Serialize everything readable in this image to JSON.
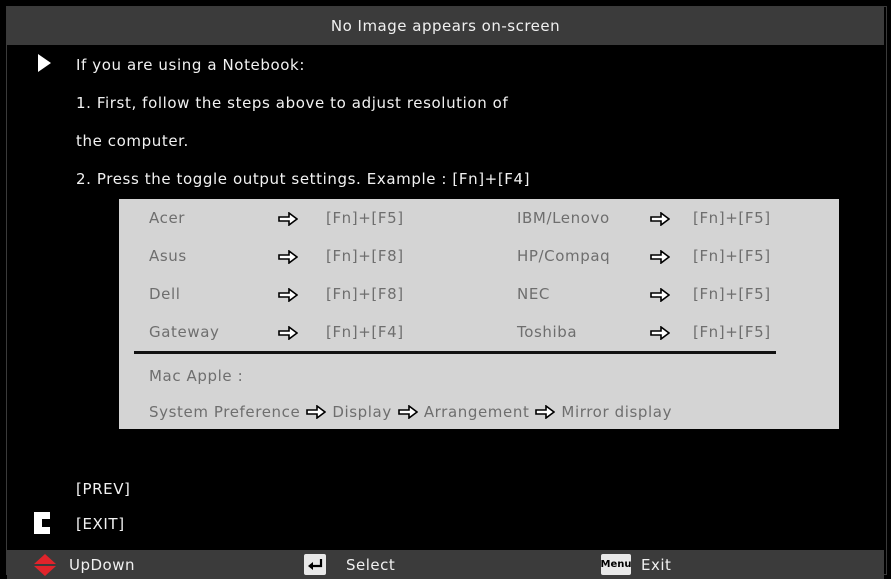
{
  "title": "No Image appears on-screen",
  "intro": "If you are using a Notebook:",
  "step1_line1": "1. First, follow the steps above to adjust resolution of",
  "step1_line2": "the computer.",
  "step2": "2. Press the toggle output settings. Example : [Fn]+[F4]",
  "brands": [
    {
      "name": "Acer",
      "keys": "[Fn]+[F5]"
    },
    {
      "name": "Asus",
      "keys": "[Fn]+[F8]"
    },
    {
      "name": "Dell",
      "keys": "[Fn]+[F8]"
    },
    {
      "name": "Gateway",
      "keys": "[Fn]+[F4]"
    },
    {
      "name": "IBM/Lenovo",
      "keys": "[Fn]+[F5]"
    },
    {
      "name": "HP/Compaq",
      "keys": "[Fn]+[F5]"
    },
    {
      "name": "NEC",
      "keys": "[Fn]+[F5]"
    },
    {
      "name": "Toshiba",
      "keys": "[Fn]+[F5]"
    }
  ],
  "mac": {
    "label": "Mac Apple :",
    "path": [
      "System Preference",
      "Display",
      "Arrangement",
      "Mirror display"
    ]
  },
  "prev": "[PREV]",
  "exit": "[EXIT]",
  "footer": {
    "updown": "UpDown",
    "select": "Select",
    "menu_key": "Menu",
    "exit": "Exit"
  },
  "colors": {
    "title_bar": "#3b3b3b",
    "panel": "#d4d4d4",
    "updown_icon": "#e0242b"
  }
}
